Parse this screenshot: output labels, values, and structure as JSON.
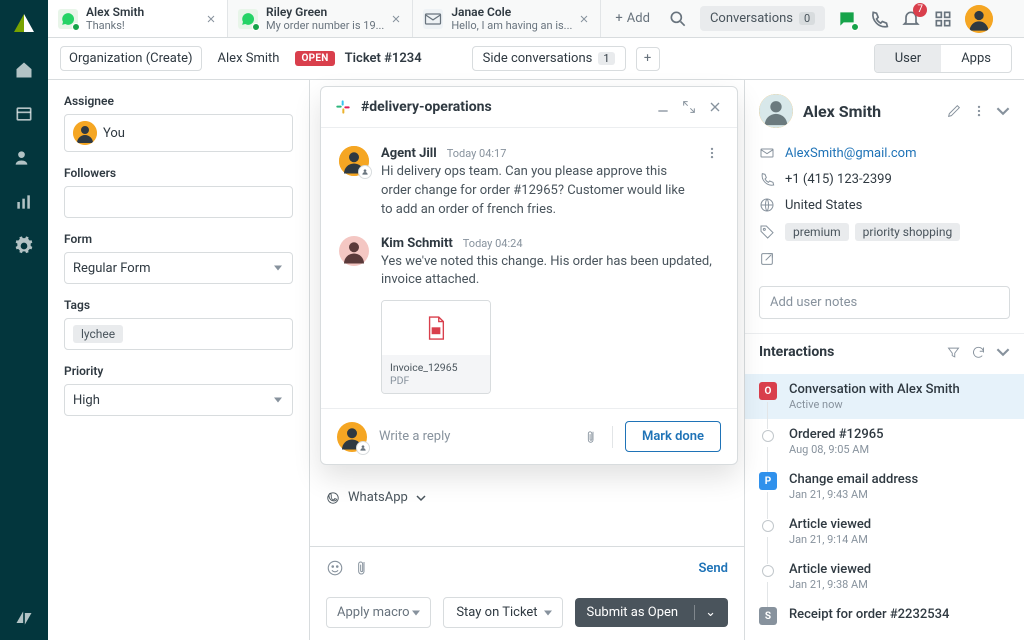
{
  "tabs": [
    {
      "title": "Alex Smith",
      "subtitle": "Thanks!",
      "channel": "whatsapp"
    },
    {
      "title": "Riley Green",
      "subtitle": "My order number is 19...",
      "channel": "whatsapp"
    },
    {
      "title": "Janae Cole",
      "subtitle": "Hello, I am having an is...",
      "channel": "email"
    }
  ],
  "tabbar": {
    "add_label": "Add",
    "conversations_label": "Conversations",
    "conversations_count": "0",
    "notifications_count": "7"
  },
  "second_bar": {
    "org_label": "Organization (Create)",
    "user_crumb": "Alex Smith",
    "ticket_status": "OPEN",
    "ticket_label": "Ticket #1234",
    "side_conv_label": "Side conversations",
    "side_conv_count": "1",
    "segment_user": "User",
    "segment_apps": "Apps"
  },
  "form": {
    "assignee_label": "Assignee",
    "assignee_value": "You",
    "followers_label": "Followers",
    "form_label": "Form",
    "form_value": "Regular Form",
    "tags_label": "Tags",
    "tags": [
      "lychee"
    ],
    "priority_label": "Priority",
    "priority_value": "High"
  },
  "slack": {
    "channel": "#delivery-operations",
    "messages": [
      {
        "author": "Agent Jill",
        "time": "Today 04:17",
        "text": "Hi delivery ops team. Can you please approve this order change for order #12965? Customer would like to add an order of french fries."
      },
      {
        "author": "Kim Schmitt",
        "time": "Today 04:24",
        "text": "Yes we've noted this change. His order has been updated, invoice attached."
      }
    ],
    "attachment": {
      "name": "Invoice_12965",
      "type": "PDF"
    },
    "reply_placeholder": "Write a reply",
    "mark_done": "Mark done"
  },
  "center": {
    "channel_label": "WhatsApp",
    "send_label": "Send",
    "macro_placeholder": "Apply macro",
    "stay_label": "Stay on Ticket",
    "submit_label": "Submit as Open"
  },
  "user": {
    "name": "Alex Smith",
    "email": "AlexSmith@gmail.com",
    "phone": "+1 (415) 123-2399",
    "location": "United States",
    "tags": [
      "premium",
      "priority shopping"
    ],
    "notes_placeholder": "Add user notes"
  },
  "interactions": {
    "title": "Interactions",
    "items": [
      {
        "marker": "open",
        "letter": "O",
        "title": "Conversation with Alex Smith",
        "sub": "Active now"
      },
      {
        "marker": "circle",
        "title": "Ordered #12965",
        "sub": "Aug 08, 9:05 AM"
      },
      {
        "marker": "pending",
        "letter": "P",
        "title": "Change email address",
        "sub": "Jan 21, 9:43 AM"
      },
      {
        "marker": "circle",
        "title": "Article viewed",
        "sub": "Jan 21, 9:14 AM"
      },
      {
        "marker": "circle",
        "title": "Article viewed",
        "sub": "Jan 21, 9:38 AM"
      },
      {
        "marker": "solved",
        "letter": "S",
        "title": "Receipt for order #2232534",
        "sub": ""
      }
    ]
  }
}
